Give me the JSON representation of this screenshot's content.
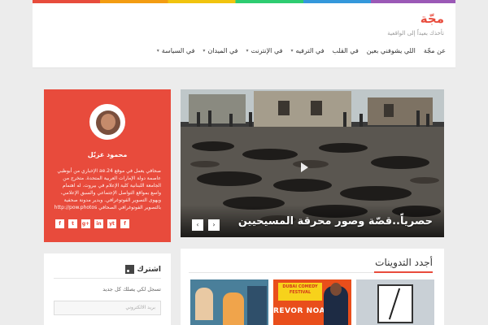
{
  "header": {
    "logo": "مجّة",
    "tagline": "تأخذك بعيداً إلى الواقعية",
    "nav": [
      {
        "label": "في السياسة",
        "caret": true
      },
      {
        "label": "في الميدان",
        "caret": true
      },
      {
        "label": "في الإنترنت",
        "caret": true
      },
      {
        "label": "في الترفيه",
        "caret": true
      },
      {
        "label": "في القلب",
        "caret": false
      },
      {
        "label": "اللي يشوفني بعين",
        "caret": false
      },
      {
        "label": "عن مجّة",
        "caret": false
      }
    ]
  },
  "slider": {
    "title": "حصرياً..قصّة وصور محرقة المسيحيين",
    "prev": "‹",
    "next": "›"
  },
  "author": {
    "name": "محمود غزيّل",
    "bio": "صحافي يعمل في موقع 24.ae الإخباري من أبوظبي عاصمة دولة الإمارات العربية المتحدة. متخرج من الجامعة اللبنانية كلية الإعلام في بيروت. له اهتمام واسع بمواقع التواصل الإجتماعي والسبق الإعلامي، ويهوى التصوير الفوتوغرافي. وبدير مدونة صحفية بالتصوير الفوتوغرافي الصحافي http://pow.photos",
    "socials": [
      "f",
      "t",
      "g+",
      "in",
      "yt",
      "f"
    ]
  },
  "subscribe": {
    "title": "اشترك",
    "text": "تسجل لكي يصلك كل جديد",
    "placeholder": "بريد الالكتروني"
  },
  "latest": {
    "title": "أجدد التدوينات",
    "thumb2_banner": "DUBAI COMEDY FESTIVAL",
    "thumb2_text": "REVOR NOAH"
  },
  "colors": {
    "accent": "#e84b3c",
    "background": "#ececec"
  }
}
